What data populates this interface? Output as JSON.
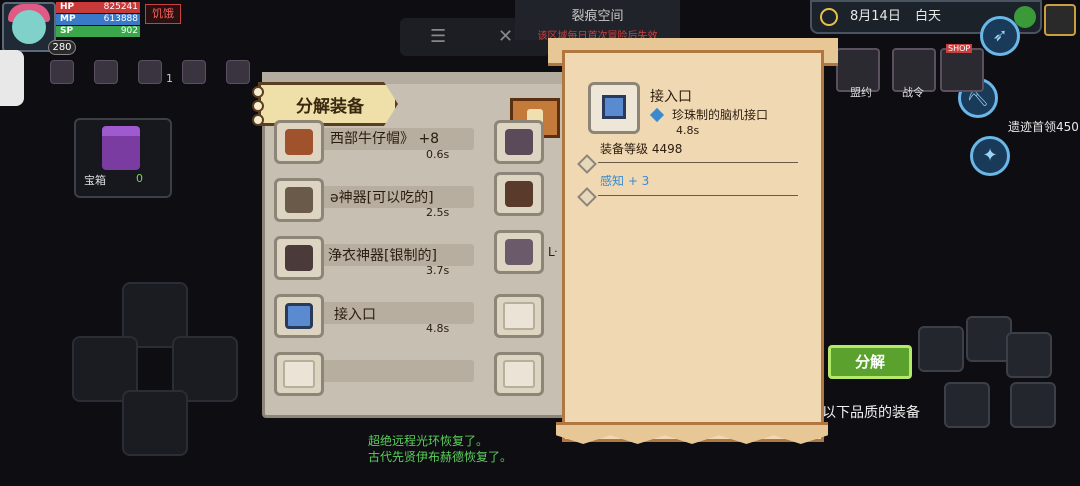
{
  "hud": {
    "hp_label": "HP",
    "hp_value": "825241",
    "mp_label": "MP",
    "mp_value": "613888",
    "sp_label": "SP",
    "sp_value": "902",
    "level": "280",
    "status": "饥饿",
    "buff_count": "1"
  },
  "chest": {
    "label": "宝箱",
    "count": "0"
  },
  "top": {
    "rift_title": "裂痕空间",
    "rift_sub": "该区域每日首次冒险后失效",
    "date": "8月14日",
    "time_of_day": "白天"
  },
  "right_menu": {
    "shop_label": "SHOP",
    "alliance_label": "盟约",
    "battle_order_label": "战令",
    "tracker": "遗迹首领450"
  },
  "panel": {
    "title": "分解装备",
    "items": [
      {
        "name": "西部牛仔帽》 +8",
        "time": "0.6s",
        "icon": "hat-icon"
      },
      {
        "name": "ǝ神器[可以吃的]",
        "time": "2.5s",
        "icon": "weapon-icon"
      },
      {
        "name": "浄衣神器[银制的]",
        "time": "3.7s",
        "icon": "armor-icon"
      },
      {
        "name": "接入口",
        "time": "4.8s",
        "icon": "chip-icon"
      },
      {
        "name": "",
        "time": "",
        "icon": ""
      }
    ],
    "right_col_partial": "ᒷ"
  },
  "tooltip": {
    "name": "接入口",
    "subtitle": "珍珠制的脑机接口",
    "time": "4.8s",
    "equip_level": "装备等级 4498",
    "attribute": "感知 + 3"
  },
  "actions": {
    "decompose": "分解",
    "below_quality": "以下品质的装备"
  },
  "log": {
    "line1": "超绝远程光环恢复了。",
    "line2": "古代先贤伊布赫德恢复了。"
  }
}
